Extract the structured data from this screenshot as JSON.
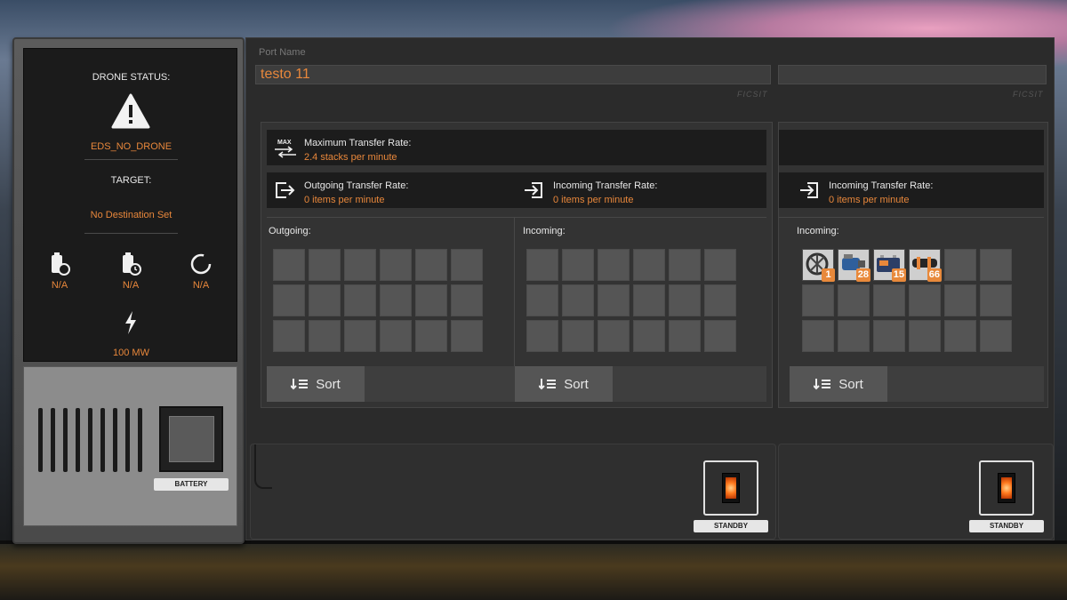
{
  "drone": {
    "status_title": "DRONE STATUS:",
    "status_value": "EDS_NO_DRONE",
    "target_title": "TARGET:",
    "target_value": "No Destination Set",
    "stats": [
      {
        "icon": "battery-refresh-icon",
        "value": "N/A"
      },
      {
        "icon": "battery-timer-icon",
        "value": "N/A"
      },
      {
        "icon": "cycle-icon",
        "value": "N/A"
      }
    ],
    "power_value": "100 MW",
    "battery_label": "BATTERY"
  },
  "port": {
    "name_label": "Port Name",
    "name_value": "testo 11",
    "brand": "FICSIT"
  },
  "transfer": {
    "max_label": "Maximum Transfer Rate:",
    "max_value": "2.4 stacks per minute",
    "outgoing_label": "Outgoing Transfer Rate:",
    "outgoing_value": "0 items per minute",
    "incoming_label": "Incoming Transfer Rate:",
    "incoming_value": "0 items per minute",
    "incoming2_label": "Incoming Transfer Rate:",
    "incoming2_value": "0 items per minute"
  },
  "inventories": {
    "outgoing_label": "Outgoing:",
    "incoming_label": "Incoming:",
    "incoming2_label": "Incoming:",
    "incoming2_items": [
      {
        "icon": "reinforced-frame-icon",
        "count": "1"
      },
      {
        "icon": "motor-icon",
        "count": "28"
      },
      {
        "icon": "battery-item-icon",
        "count": "15"
      },
      {
        "icon": "cable-bundle-icon",
        "count": "66"
      }
    ]
  },
  "buttons": {
    "sort_label": "Sort",
    "standby_label": "STANDBY"
  },
  "colors": {
    "accent": "#e8873b",
    "panel": "#2b2b2b"
  }
}
